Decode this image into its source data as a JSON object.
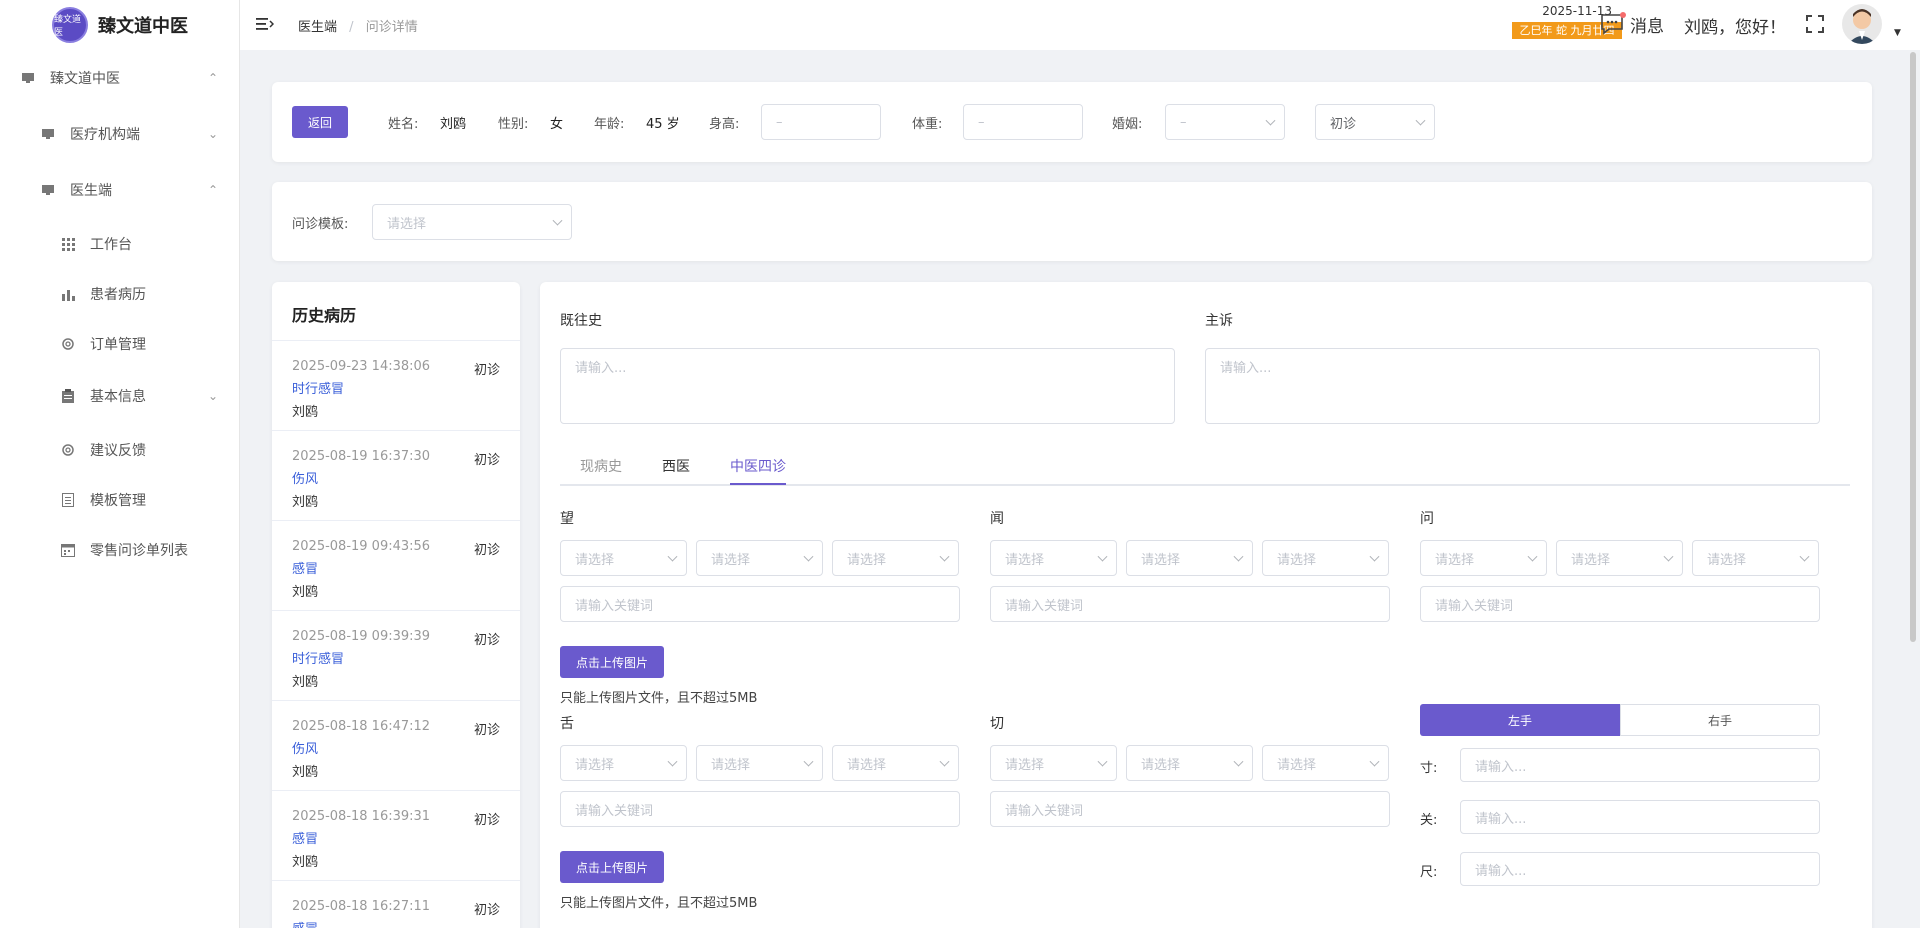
{
  "app": {
    "title": "臻文道中医",
    "logo_text": "臻文道医"
  },
  "sidebar": {
    "items": [
      {
        "label": "臻文道中医",
        "icon": "monitor-icon",
        "arrow": "up"
      },
      {
        "label": "医疗机构端",
        "icon": "monitor-icon",
        "arrow": "down"
      },
      {
        "label": "医生端",
        "icon": "monitor-icon",
        "arrow": "up"
      },
      {
        "label": "工作台",
        "icon": "grid-icon"
      },
      {
        "label": "患者病历",
        "icon": "bar-chart-icon"
      },
      {
        "label": "订单管理",
        "icon": "gear-icon"
      },
      {
        "label": "基本信息",
        "icon": "clipboard-icon",
        "arrow": "down"
      },
      {
        "label": "建议反馈",
        "icon": "gear-icon"
      },
      {
        "label": "模板管理",
        "icon": "document-icon"
      },
      {
        "label": "零售问诊单列表",
        "icon": "calendar-icon"
      }
    ]
  },
  "header": {
    "breadcrumb": [
      "医生端",
      "问诊详情"
    ],
    "breadcrumb_sep": "/",
    "date": "2025-11-13",
    "lunar": "乙巳年 蛇 九月廿四",
    "messages_label": "消息",
    "greeting": "刘鸥，您好！"
  },
  "patient": {
    "back_label": "返回",
    "name_label": "姓名:",
    "name": "刘鸥",
    "gender_label": "性别:",
    "gender": "女",
    "age_label": "年龄:",
    "age": "45 岁",
    "height_label": "身高:",
    "height_placeholder": "–",
    "weight_label": "体重:",
    "weight_placeholder": "–",
    "marriage_label": "婚姻:",
    "marriage_value": "–",
    "visit_type": "初诊"
  },
  "template": {
    "label": "问诊模板:",
    "placeholder": "请选择"
  },
  "history": {
    "title": "历史病历",
    "items": [
      {
        "date": "2025-09-23 14:38:06",
        "type": "初诊",
        "diagnosis": "时行感冒",
        "name": "刘鸥"
      },
      {
        "date": "2025-08-19 16:37:30",
        "type": "初诊",
        "diagnosis": "伤风",
        "name": "刘鸥"
      },
      {
        "date": "2025-08-19 09:43:56",
        "type": "初诊",
        "diagnosis": "感冒",
        "name": "刘鸥"
      },
      {
        "date": "2025-08-19 09:39:39",
        "type": "初诊",
        "diagnosis": "时行感冒",
        "name": "刘鸥"
      },
      {
        "date": "2025-08-18 16:47:12",
        "type": "初诊",
        "diagnosis": "伤风",
        "name": "刘鸥"
      },
      {
        "date": "2025-08-18 16:39:31",
        "type": "初诊",
        "diagnosis": "感冒",
        "name": "刘鸥"
      },
      {
        "date": "2025-08-18 16:27:11",
        "type": "初诊",
        "diagnosis": "感冒",
        "name": ""
      }
    ]
  },
  "form": {
    "past_history_label": "既往史",
    "chief_complaint_label": "主诉",
    "textarea_placeholder": "请输入...",
    "tabs": [
      "现病史",
      "西医",
      "中医四诊"
    ],
    "active_tab": "中医四诊",
    "select_placeholder": "请选择",
    "keyword_placeholder": "请输入关键词",
    "upload_label": "点击上传图片",
    "upload_hint": "只能上传图片文件，且不超过5MB",
    "look_label": "望",
    "listen_label": "闻",
    "ask_label": "问",
    "tongue_label": "舌",
    "pulse_label": "切",
    "left_hand": "左手",
    "right_hand": "右手",
    "cun_label": "寸:",
    "guan_label": "关:",
    "chi_label": "尺:",
    "pulse_placeholder": "请输入..."
  },
  "colors": {
    "primary": "#6a5acd",
    "link": "#3a5fd9",
    "lunar_bg": "#f29a1a"
  }
}
